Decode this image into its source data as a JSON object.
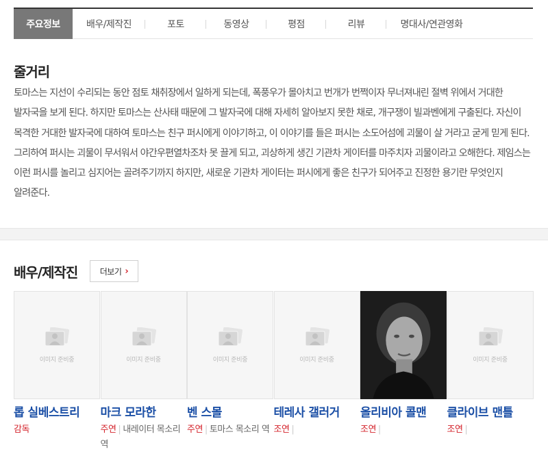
{
  "tabs": [
    {
      "label": "주요정보",
      "active": true
    },
    {
      "label": "배우/제작진",
      "active": false
    },
    {
      "label": "포토",
      "active": false
    },
    {
      "label": "동영상",
      "active": false
    },
    {
      "label": "평점",
      "active": false
    },
    {
      "label": "리뷰",
      "active": false
    },
    {
      "label": "명대사/연관영화",
      "active": false
    }
  ],
  "synopsis": {
    "title": "줄거리",
    "text": "토마스는 지선이 수리되는 동안 점토 채취장에서 일하게 되는데, 폭풍우가 몰아치고 번개가 번쩍이자 무너져내린 절벽 위에서 거대한 발자국을 보게 된다. 하지만 토마스는 산사태 때문에 그 발자국에 대해 자세히 알아보지 못한 채로, 개구쟁이 빌과벤에게 구출된다. 자신이 목격한 거대한 발자국에 대하여 토마스는 친구 퍼시에게 이야기하고, 이 이야기를 들은 퍼시는 소도어섬에 괴물이 살 거라고 굳게 믿게 된다. 그리하여 퍼시는 괴물이 무서워서 야간우편열차조차 못 끌게 되고, 괴상하게 생긴 기관차 게이터를 마주치자 괴물이라고 오해한다. 제임스는 이런 퍼시를 놀리고 심지어는 골려주기까지 하지만, 새로운 기관차 게이터는 퍼시에게 좋은 친구가 되어주고 진정한 용기란 무엇인지 알려준다."
  },
  "cast": {
    "title": "배우/제작진",
    "more_label": "더보기",
    "placeholder_text": "이미지 준비중",
    "members": [
      {
        "name": "롭 실베스트리",
        "role_type": "감독",
        "role": "",
        "has_photo": false
      },
      {
        "name": "마크 모라한",
        "role_type": "주연",
        "role": "내레이터 목소리 역",
        "has_photo": false
      },
      {
        "name": "벤 스몰",
        "role_type": "주연",
        "role": "토마스 목소리 역",
        "has_photo": false
      },
      {
        "name": "테레사 갤러거",
        "role_type": "조연",
        "role": "",
        "has_photo": false
      },
      {
        "name": "올리비아 콜맨",
        "role_type": "조연",
        "role": "",
        "has_photo": true
      },
      {
        "name": "클라이브 맨틀",
        "role_type": "조연",
        "role": "",
        "has_photo": false
      }
    ]
  },
  "colors": {
    "active_tab": "#787878",
    "name_link": "#1b4fa6",
    "role_type": "#d4232b"
  }
}
